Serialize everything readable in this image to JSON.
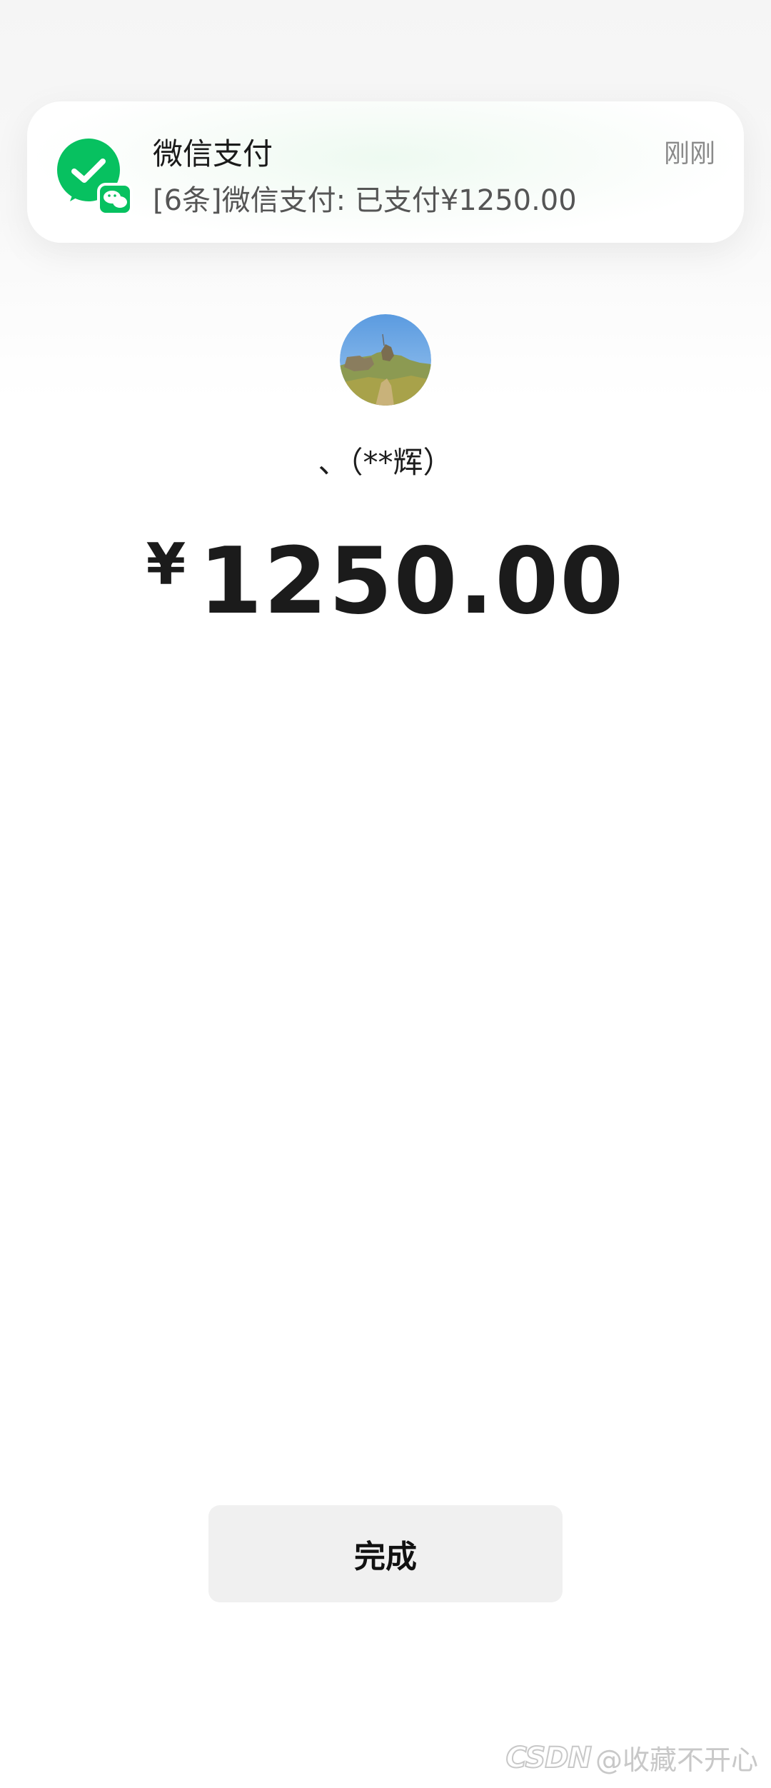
{
  "notification": {
    "app_name": "微信支付",
    "message": "[6条]微信支付: 已支付¥1250.00",
    "time": "刚刚",
    "icon": "wechat-pay-icon"
  },
  "payee": {
    "avatar": "landscape-avatar",
    "name": "、（**辉）"
  },
  "payment": {
    "currency": "¥",
    "amount": "1250.00"
  },
  "actions": {
    "done_label": "完成"
  },
  "watermark": {
    "logo": "CSDN",
    "text": "@收藏不开心"
  },
  "colors": {
    "wechat_green": "#07c160",
    "button_bg": "#f0f0f0"
  }
}
